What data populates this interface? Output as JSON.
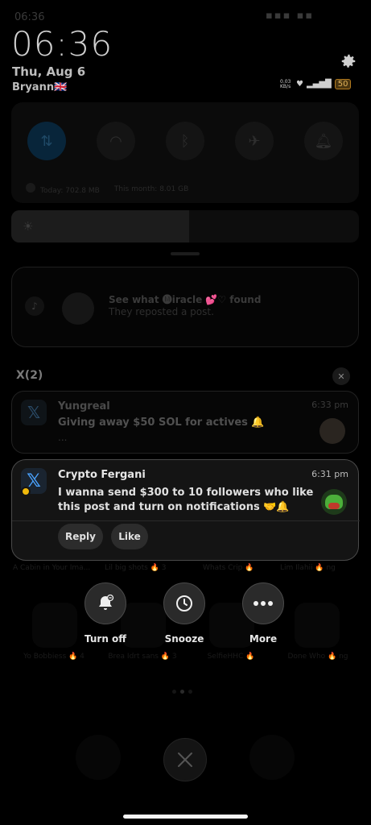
{
  "status": {
    "small_time": "06:36",
    "clock": "06:36",
    "date": "Thu, Aug 6",
    "carrier": "Bryann🇬🇧",
    "speed": "0.03\nKB/s",
    "battery": "50"
  },
  "quick_settings": {
    "data_today": "Today: 702.8 MB",
    "data_month": "This month: 8.01 GB"
  },
  "tiktok_notification": {
    "title": "See what 🅜iracle 💕♡ found",
    "body": "They reposted a post."
  },
  "group": {
    "label": "X(2)"
  },
  "notifications": [
    {
      "title": "Yungreal",
      "body": "Giving away $50 SOL for actives 🔔",
      "ellipsis": "...",
      "time": "6:33 pm"
    },
    {
      "title": "Crypto Fergani",
      "body": "I wanna send $300 to 10 followers who like this post and turn on notifications 🤝🔔",
      "time": "6:31 pm",
      "actions": [
        "Reply",
        "Like"
      ]
    }
  ],
  "long_press_actions": [
    {
      "label": "Turn off",
      "icon": "bell-off-icon"
    },
    {
      "label": "Snooze",
      "icon": "clock-icon"
    },
    {
      "label": "More",
      "icon": "more-dots-icon"
    }
  ],
  "background_labels": [
    "A Cabin in Your Ima...",
    "Lil big shots 🔥 3",
    "Whats Crip 🔥",
    "Lim Ilahii 🔥 ng"
  ],
  "background_labels_2": [
    "Yo Bobbiess 🔥 4",
    "Brea Idrt sans 🔥 3",
    "SelfieHHC 🔥",
    "Done Who 🔥 ng"
  ],
  "colors": {
    "accent_blue": "#4aa3ff",
    "battery": "#e0b35a"
  }
}
